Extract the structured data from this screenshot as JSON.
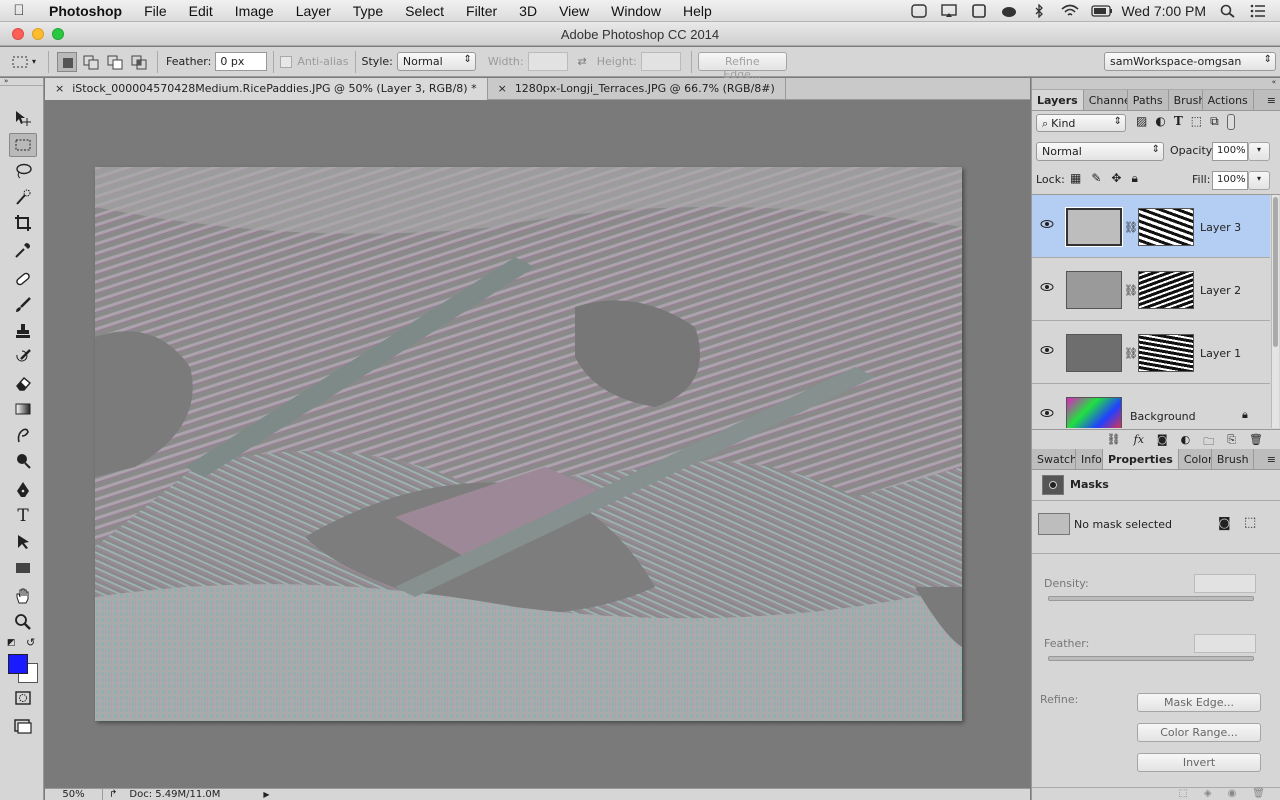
{
  "menubar": {
    "app_name": "Photoshop",
    "items": [
      "File",
      "Edit",
      "Image",
      "Layer",
      "Type",
      "Select",
      "Filter",
      "3D",
      "View",
      "Window",
      "Help"
    ],
    "clock": "Wed 7:00 PM"
  },
  "window": {
    "title": "Adobe Photoshop CC 2014"
  },
  "options": {
    "feather_label": "Feather:",
    "feather_value": "0 px",
    "antialias_label": "Anti-alias",
    "style_label": "Style:",
    "style_value": "Normal",
    "width_label": "Width:",
    "height_label": "Height:",
    "refine_edge": "Refine Edge...",
    "workspace": "samWorkspace-omgsan"
  },
  "doc_tabs": [
    {
      "label": "iStock_000004570428Medium.RicePaddies.JPG @ 50% (Layer 3, RGB/8) *"
    },
    {
      "label": "1280px-Longji_Terraces.JPG @ 66.7% (RGB/8#)"
    }
  ],
  "status": {
    "zoom": "50%",
    "doc": "Doc: 5.49M/11.0M"
  },
  "layers_panel": {
    "tabs": [
      "Layers",
      "Channel",
      "Paths",
      "Brush",
      "Actions"
    ],
    "kind_label": "Kind",
    "blend_mode": "Normal",
    "opacity_label": "Opacity:",
    "opacity_value": "100%",
    "lock_label": "Lock:",
    "fill_label": "Fill:",
    "fill_value": "100%",
    "layers": [
      {
        "name": "Layer 3",
        "selected": true
      },
      {
        "name": "Layer 2",
        "selected": false
      },
      {
        "name": "Layer 1",
        "selected": false
      },
      {
        "name": "Background",
        "selected": false
      }
    ]
  },
  "properties_panel": {
    "tabs": [
      "Swatch",
      "Info",
      "Properties",
      "Color",
      "Brush P"
    ],
    "title": "Masks",
    "no_mask": "No mask selected",
    "density_label": "Density:",
    "feather_label": "Feather:",
    "refine_label": "Refine:",
    "mask_edge": "Mask Edge...",
    "color_range": "Color Range...",
    "invert": "Invert"
  },
  "colors": {
    "foreground": "#1a1aff",
    "background": "#ffffff",
    "selection": "#b4cdf2"
  }
}
